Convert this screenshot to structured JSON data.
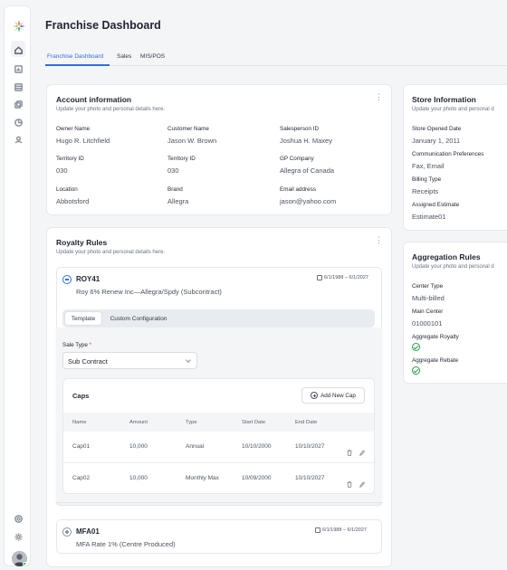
{
  "page": {
    "title": "Franchise Dashboard"
  },
  "tabs": [
    "Franchise Dashboard",
    "Sales",
    "MIS/POS"
  ],
  "account": {
    "title": "Account information",
    "subtitle": "Update your photo and personal details here.",
    "fields": [
      {
        "label": "Owner Name",
        "value": "Hugo R. Litchfield"
      },
      {
        "label": "Customer Name",
        "value": "Jason W. Brown"
      },
      {
        "label": "Salesperson ID",
        "value": "Joshua H. Maxey"
      },
      {
        "label": "Territory ID",
        "value": "030"
      },
      {
        "label": "Territory ID",
        "value": "030"
      },
      {
        "label": "GP Company",
        "value": "Allegra of Canada"
      },
      {
        "label": "Location",
        "value": "Abbotsford"
      },
      {
        "label": "Brand",
        "value": "Allegra"
      },
      {
        "label": "Email address",
        "value": "jason@yahoo.com"
      }
    ]
  },
  "royalty": {
    "title": "Royalty Rules",
    "subtitle": "Update your photo and personal details here.",
    "rule1": {
      "code": "ROY41",
      "dates": "6/1/1988 – 6/1/2027",
      "desc": "Roy 6% Renew Inc—Allegra/Spdy (Subcontract)"
    },
    "seg": [
      "Template",
      "Custom Configuration"
    ],
    "sale_type_label": "Sale Type",
    "required_mark": "*",
    "sale_type_value": "Sub Contract",
    "caps": {
      "title": "Caps",
      "add_label": "Add New Cap",
      "headers": [
        "Name",
        "Amount",
        "Type",
        "Start Date",
        "End Date"
      ],
      "rows": [
        [
          "Cap01",
          "10,000",
          "Annual",
          "10/10/2000",
          "10/10/2027"
        ],
        [
          "Cap02",
          "10,000",
          "Monthly Max",
          "10/09/2000",
          "10/10/2027"
        ]
      ]
    },
    "rule2": {
      "code": "MFA01",
      "dates": "6/1/1988 – 6/1/2027",
      "desc": "MFA Rate 1% (Centre Produced)"
    }
  },
  "store": {
    "title": "Store Information",
    "subtitle": "Update your photo and personal d",
    "fields": [
      {
        "label": "Store Opened Date",
        "value": "January 1, 2011"
      },
      {
        "label": "Communication Preferences",
        "value": "Fax, Email"
      },
      {
        "label": "Billing Type",
        "value": "Receipts"
      },
      {
        "label": "Assigned Estimate",
        "value": "Estimate01"
      }
    ]
  },
  "aggregation": {
    "title": "Aggregation Rules",
    "subtitle": "Update your photo and personal d",
    "fields": [
      {
        "label": "Center Type",
        "value": "Multi-billed"
      },
      {
        "label": "Main Center",
        "value": "01000101"
      },
      {
        "label": "Aggregate Royalty",
        "value": ""
      },
      {
        "label": "Aggregate Rebate",
        "value": ""
      }
    ]
  },
  "colors": {
    "accent": "#2f6fe0",
    "success": "#22a04b"
  },
  "icons": [
    "app-logo-icon",
    "home-icon",
    "report-icon",
    "database-icon",
    "copy-icon",
    "chart-pie-icon",
    "users-icon",
    "help-icon",
    "settings-icon"
  ]
}
